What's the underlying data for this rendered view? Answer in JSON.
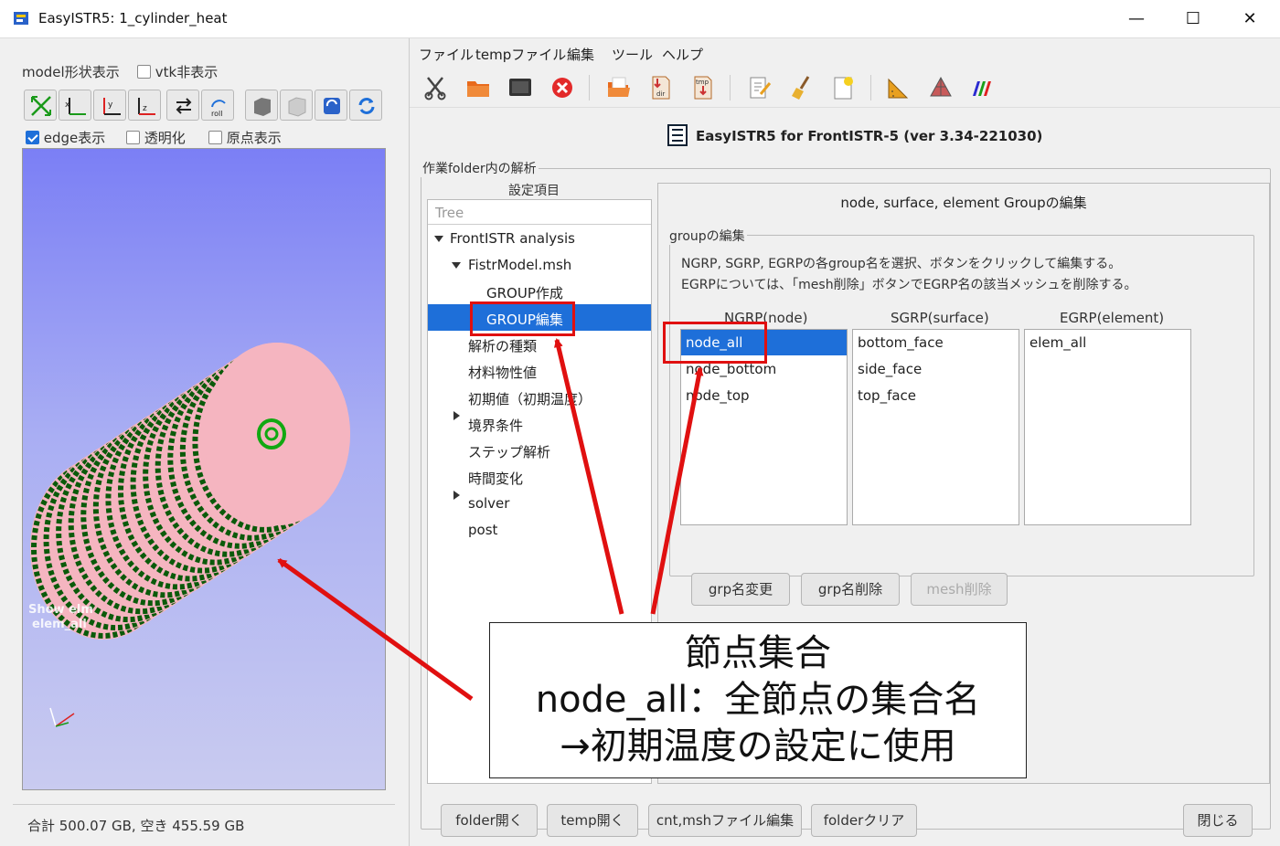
{
  "window": {
    "title": "EasyISTR5: 1_cylinder_heat",
    "minimize": "—",
    "maximize": "☐",
    "close": "✕"
  },
  "left": {
    "model_shape_label": "model形状表示",
    "vtk_hide_label": "vtk非表示",
    "view_buttons": [
      "fit-icon",
      "view-x-icon",
      "view-y-icon",
      "view-z-icon",
      "swap-icon",
      "roll-icon",
      "solid-box-icon",
      "wire-box-icon",
      "reload-icon",
      "refresh-icon"
    ],
    "edge_label": "edge表示",
    "edge_checked": true,
    "transparent_label": "透明化",
    "origin_label": "原点表示",
    "viewport_text1": "Show elm",
    "viewport_text2": "elem_all",
    "status": "合計 500.07 GB, 空き 455.59 GB"
  },
  "menu": [
    "ファイル",
    "tempファイル",
    "編集",
    "ツール",
    "ヘルプ"
  ],
  "toolbar": [
    "scissors-icon",
    "folder-icon",
    "terminal-icon",
    "stop-icon",
    "open-folder-icon",
    "dir-icon",
    "tmp-icon",
    "edit-icon",
    "broom-icon",
    "new-doc-icon",
    "ruler-icon",
    "mesh-icon",
    "paraview-icon"
  ],
  "header": {
    "title": "EasyISTR5 for FrontISTR-5  (ver 3.34-221030)"
  },
  "analysis": {
    "group_label": "作業folder内の解析",
    "settings_label": "設定項目",
    "tree_placeholder": "Tree",
    "tree": [
      "FrontISTR analysis",
      "FistrModel.msh",
      "GROUP作成",
      "GROUP編集",
      "解析の種類",
      "材料物性値",
      "初期値（初期温度）",
      "境界条件",
      "ステップ解析",
      "時間変化",
      "solver",
      "post"
    ]
  },
  "groups": {
    "panel_title": "node, surface, element Groupの編集",
    "section_label": "groupの編集",
    "desc1": "NGRP, SGRP, EGRPの各group名を選択、ボタンをクリックして編集する。",
    "desc2": "EGRPについては、「mesh削除」ボタンでEGRP名の該当メッシュを削除する。",
    "ngrp_header": "NGRP(node)",
    "sgrp_header": "SGRP(surface)",
    "egrp_header": "EGRP(element)",
    "ngrp": [
      "node_all",
      "node_bottom",
      "node_top"
    ],
    "sgrp": [
      "bottom_face",
      "side_face",
      "top_face"
    ],
    "egrp": [
      "elem_all"
    ],
    "rename_button": "grp名変更",
    "delete_button": "grp名削除",
    "mesh_delete_button": "mesh削除"
  },
  "bottom": {
    "folder_open": "folder開く",
    "temp_open": "temp開く",
    "cnt_msh_edit": "cnt,mshファイル編集",
    "folder_clear": "folderクリア",
    "close": "閉じる"
  },
  "callout": {
    "line1": "節点集合",
    "line2": "node_all：全節点の集合名",
    "line3": "→初期温度の設定に使用"
  },
  "colors": {
    "selection": "#1e6fd9",
    "annotation": "#e01010",
    "mesh_fill": "#f5b5c0",
    "mesh_edge": "#0a5a0a"
  }
}
